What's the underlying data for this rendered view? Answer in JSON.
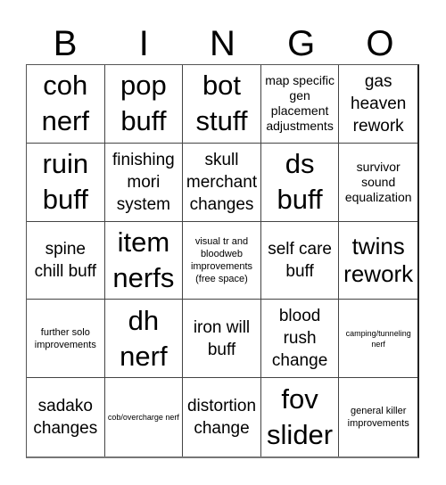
{
  "header": {
    "letters": [
      "B",
      "I",
      "N",
      "G",
      "O"
    ]
  },
  "card": {
    "cells": [
      {
        "text": "coh nerf"
      },
      {
        "text": "pop buff"
      },
      {
        "text": "bot stuff"
      },
      {
        "text": "map specific gen placement adjustments"
      },
      {
        "text": "gas heaven rework"
      },
      {
        "text": "ruin buff"
      },
      {
        "text": "finishing mori system"
      },
      {
        "text": "skull merchant changes"
      },
      {
        "text": "ds buff"
      },
      {
        "text": "survivor sound equalization"
      },
      {
        "text": "spine chill buff"
      },
      {
        "text": "item nerfs"
      },
      {
        "text": "visual tr and bloodweb improvements (free space)"
      },
      {
        "text": "self care buff"
      },
      {
        "text": "twins rework"
      },
      {
        "text": "further solo improvements"
      },
      {
        "text": "dh nerf"
      },
      {
        "text": "iron will buff"
      },
      {
        "text": "blood rush change"
      },
      {
        "text": "camping/tunneling nerf"
      },
      {
        "text": "sadako changes"
      },
      {
        "text": "cob/overcharge nerf"
      },
      {
        "text": "distortion change"
      },
      {
        "text": "fov slider"
      },
      {
        "text": "general killer improvements"
      }
    ]
  }
}
